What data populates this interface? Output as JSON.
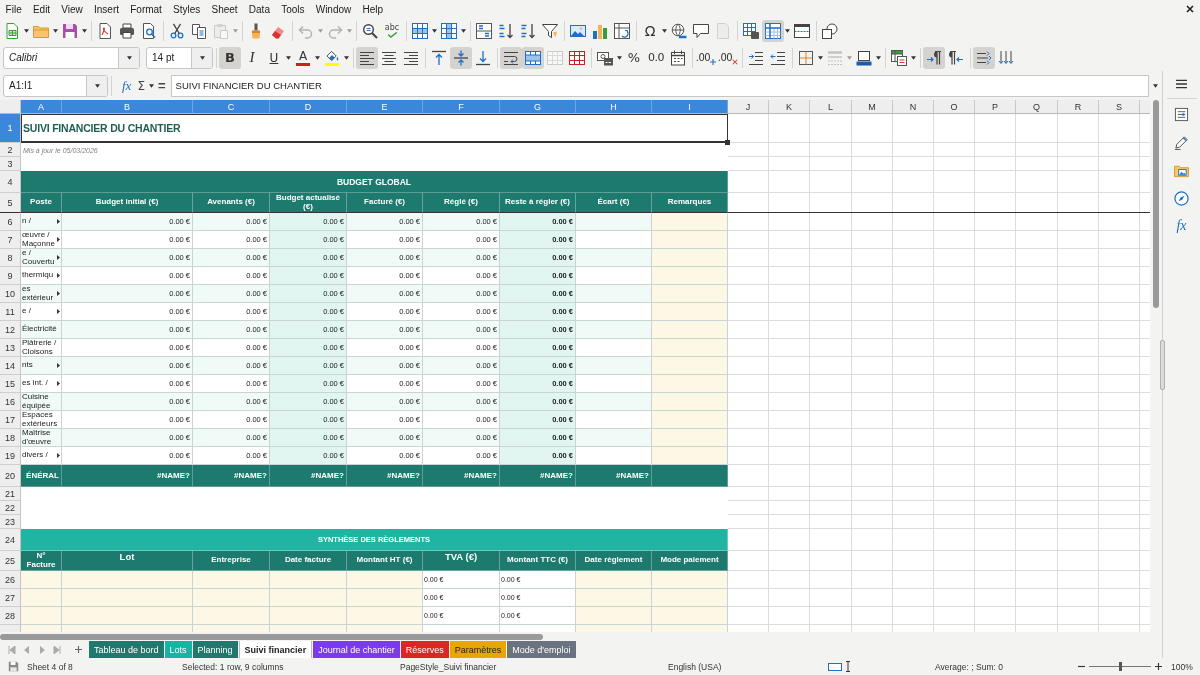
{
  "menu_bar": [
    "File",
    "Edit",
    "View",
    "Insert",
    "Format",
    "Styles",
    "Sheet",
    "Data",
    "Tools",
    "Window",
    "Help"
  ],
  "standard_toolbar": [
    {
      "pressed": false,
      "disabled": false
    },
    {
      "pressed": false,
      "disabled": false
    },
    {
      "pressed": false,
      "disabled": false
    },
    {
      "pressed": false,
      "disabled": false
    },
    {
      "pressed": false,
      "disabled": false
    },
    {
      "pressed": false,
      "disabled": false
    },
    {
      "pressed": false,
      "disabled": false
    },
    {
      "pressed": false,
      "disabled": false
    },
    {
      "pressed": false,
      "disabled": true
    },
    {
      "pressed": false,
      "disabled": false
    },
    {
      "pressed": false,
      "disabled": false
    },
    {
      "pressed": false,
      "disabled": true
    },
    {
      "pressed": false,
      "disabled": true
    },
    {
      "pressed": false,
      "disabled": false
    },
    {
      "pressed": false,
      "disabled": false,
      "glyph": "abc"
    },
    {
      "pressed": false,
      "disabled": false
    },
    {
      "pressed": false,
      "disabled": false
    },
    {
      "pressed": false,
      "disabled": false
    },
    {
      "pressed": false,
      "disabled": false
    },
    {
      "pressed": false,
      "disabled": false
    },
    {
      "pressed": false,
      "disabled": false
    },
    {
      "pressed": false,
      "disabled": false
    },
    {
      "pressed": false,
      "disabled": false
    },
    {
      "pressed": false,
      "disabled": false
    },
    {
      "pressed": false,
      "disabled": false,
      "glyph": "Ω"
    },
    {
      "pressed": false,
      "disabled": false
    },
    {
      "pressed": false,
      "disabled": false
    },
    {
      "pressed": false,
      "disabled": true
    },
    {
      "pressed": false,
      "disabled": false
    },
    {
      "pressed": true,
      "disabled": false
    },
    {
      "pressed": false,
      "disabled": false
    },
    {
      "pressed": false,
      "disabled": false
    }
  ],
  "formatting_toolbar": {
    "font_name": "Calibri",
    "font_size": "14 pt",
    "buttons": [
      {
        "pressed": true,
        "disabled": false,
        "glyph": "B"
      },
      {
        "pressed": false,
        "disabled": false,
        "glyph": "I"
      },
      {
        "pressed": false,
        "disabled": false,
        "glyph": "U"
      },
      {
        "pressed": false,
        "disabled": false,
        "glyph": "A",
        "color": "#c9211e"
      },
      {
        "pressed": false,
        "disabled": false,
        "color": "#ffff00"
      },
      {
        "pressed": true,
        "disabled": false
      },
      {
        "pressed": false,
        "disabled": false
      },
      {
        "pressed": false,
        "disabled": false
      },
      {
        "pressed": false,
        "disabled": false
      },
      {
        "pressed": true,
        "disabled": false
      },
      {
        "pressed": false,
        "disabled": false
      },
      {
        "pressed": true,
        "disabled": false
      },
      {
        "pressed": true,
        "disabled": false
      },
      {
        "pressed": false,
        "disabled": true
      },
      {
        "pressed": false,
        "disabled": false
      },
      {
        "pressed": false,
        "disabled": false
      },
      {
        "pressed": false,
        "disabled": false,
        "glyph": "%"
      },
      {
        "pressed": false,
        "disabled": false,
        "glyph": "0.0"
      },
      {
        "pressed": false,
        "disabled": false
      },
      {
        "pressed": false,
        "disabled": false,
        "glyph": ".00"
      },
      {
        "pressed": false,
        "disabled": false,
        "glyph": ".00"
      },
      {
        "pressed": false,
        "disabled": false
      },
      {
        "pressed": false,
        "disabled": false
      },
      {
        "pressed": false,
        "disabled": false
      },
      {
        "pressed": false,
        "disabled": true
      },
      {
        "pressed": false,
        "disabled": false
      },
      {
        "pressed": false,
        "disabled": false
      },
      {
        "pressed": true,
        "disabled": false
      },
      {
        "pressed": false,
        "disabled": false
      },
      {
        "pressed": true,
        "disabled": false
      },
      {
        "pressed": false,
        "disabled": false
      }
    ]
  },
  "formula_bar": {
    "name_box": "A1:I1",
    "function_wizard": "fx",
    "sum": "Σ",
    "equals": "=",
    "content": "SUIVI FINANCIER DU CHANTIER"
  },
  "sidebar": {
    "functions": "fx"
  },
  "sheet": {
    "columns": [
      {
        "label": "A",
        "selected": true
      },
      {
        "label": "B",
        "selected": true
      },
      {
        "label": "C",
        "selected": true
      },
      {
        "label": "D",
        "selected": true
      },
      {
        "label": "E",
        "selected": true
      },
      {
        "label": "F",
        "selected": true
      },
      {
        "label": "G",
        "selected": true
      },
      {
        "label": "H",
        "selected": true
      },
      {
        "label": "I",
        "selected": true
      },
      {
        "label": "J",
        "selected": false
      },
      {
        "label": "K",
        "selected": false
      },
      {
        "label": "L",
        "selected": false
      },
      {
        "label": "M",
        "selected": false
      },
      {
        "label": "N",
        "selected": false
      },
      {
        "label": "O",
        "selected": false
      },
      {
        "label": "P",
        "selected": false
      },
      {
        "label": "Q",
        "selected": false
      },
      {
        "label": "R",
        "selected": false
      },
      {
        "label": "S",
        "selected": false
      }
    ],
    "rows": [
      {
        "label": "1",
        "selected": true
      },
      {
        "label": "2",
        "selected": false
      },
      {
        "label": "3",
        "selected": false
      },
      {
        "label": "4",
        "selected": false
      },
      {
        "label": "5",
        "selected": false
      },
      {
        "label": "6",
        "selected": false
      },
      {
        "label": "7",
        "selected": false
      },
      {
        "label": "8",
        "selected": false
      },
      {
        "label": "9",
        "selected": false
      },
      {
        "label": "10",
        "selected": false
      },
      {
        "label": "11",
        "selected": false
      },
      {
        "label": "12",
        "selected": false
      },
      {
        "label": "13",
        "selected": false
      },
      {
        "label": "14",
        "selected": false
      },
      {
        "label": "15",
        "selected": false
      },
      {
        "label": "16",
        "selected": false
      },
      {
        "label": "17",
        "selected": false
      },
      {
        "label": "18",
        "selected": false
      },
      {
        "label": "19",
        "selected": false
      },
      {
        "label": "20",
        "selected": false
      },
      {
        "label": "21",
        "selected": false
      },
      {
        "label": "22",
        "selected": false
      },
      {
        "label": "23",
        "selected": false
      },
      {
        "label": "24",
        "selected": false
      },
      {
        "label": "25",
        "selected": false
      },
      {
        "label": "26",
        "selected": false
      },
      {
        "label": "27",
        "selected": false
      },
      {
        "label": "28",
        "selected": false
      }
    ],
    "title": "SUIVI FINANCIER DU CHANTIER",
    "subtitle": "Mis à jour le 05/03/2026",
    "budget": {
      "title": "BUDGET GLOBAL",
      "columns": [
        "Poste",
        "Budget initial (€)",
        "Avenants (€)",
        "Budget actualisé (€)",
        "Facturé (€)",
        "Réglé (€)",
        "Reste à régler (€)",
        "Écart (€)",
        "Remarques"
      ],
      "rows": [
        {
          "poste": "n /",
          "overflow": true,
          "values": [
            "0.00 €",
            "0.00 €",
            "0.00 €",
            "0.00 €",
            "0.00 €",
            "0.00 €"
          ]
        },
        {
          "poste": "œuvre /\nMaçonne",
          "overflow": true,
          "values": [
            "0.00 €",
            "0.00 €",
            "0.00 €",
            "0.00 €",
            "0.00 €",
            "0.00 €"
          ]
        },
        {
          "poste": "e /\nCouvertu",
          "overflow": true,
          "values": [
            "0.00 €",
            "0.00 €",
            "0.00 €",
            "0.00 €",
            "0.00 €",
            "0.00 €"
          ]
        },
        {
          "poste": "thermiqu",
          "overflow": true,
          "values": [
            "0.00 €",
            "0.00 €",
            "0.00 €",
            "0.00 €",
            "0.00 €",
            "0.00 €"
          ]
        },
        {
          "poste": "es\nextérieur",
          "overflow": true,
          "values": [
            "0.00 €",
            "0.00 €",
            "0.00 €",
            "0.00 €",
            "0.00 €",
            "0.00 €"
          ]
        },
        {
          "poste": "e /",
          "overflow": true,
          "values": [
            "0.00 €",
            "0.00 €",
            "0.00 €",
            "0.00 €",
            "0.00 €",
            "0.00 €"
          ]
        },
        {
          "poste": "Électricité",
          "overflow": false,
          "values": [
            "0.00 €",
            "0.00 €",
            "0.00 €",
            "0.00 €",
            "0.00 €",
            "0.00 €"
          ]
        },
        {
          "poste": "Plâtrerie /\nCloisons",
          "overflow": false,
          "values": [
            "0.00 €",
            "0.00 €",
            "0.00 €",
            "0.00 €",
            "0.00 €",
            "0.00 €"
          ]
        },
        {
          "poste": "nts",
          "overflow": true,
          "values": [
            "0.00 €",
            "0.00 €",
            "0.00 €",
            "0.00 €",
            "0.00 €",
            "0.00 €"
          ]
        },
        {
          "poste": "es int. /",
          "overflow": true,
          "values": [
            "0.00 €",
            "0.00 €",
            "0.00 €",
            "0.00 €",
            "0.00 €",
            "0.00 €"
          ]
        },
        {
          "poste": "Cuisine\néquipée",
          "overflow": false,
          "values": [
            "0.00 €",
            "0.00 €",
            "0.00 €",
            "0.00 €",
            "0.00 €",
            "0.00 €"
          ]
        },
        {
          "poste": "Espaces\nextérieurs",
          "overflow": false,
          "values": [
            "0.00 €",
            "0.00 €",
            "0.00 €",
            "0.00 €",
            "0.00 €",
            "0.00 €"
          ]
        },
        {
          "poste": "Maîtrise\nd'œuvre",
          "overflow": false,
          "values": [
            "0.00 €",
            "0.00 €",
            "0.00 €",
            "0.00 €",
            "0.00 €",
            "0.00 €"
          ]
        },
        {
          "poste": "divers /",
          "overflow": true,
          "values": [
            "0.00 €",
            "0.00 €",
            "0.00 €",
            "0.00 €",
            "0.00 €",
            "0.00 €"
          ]
        }
      ],
      "total": {
        "label": "ÉNÉRAL",
        "values": [
          "#NAME?",
          "#NAME?",
          "#NAME?",
          "#NAME?",
          "#NAME?",
          "#NAME?",
          "#NAME?"
        ]
      }
    },
    "payments": {
      "title": "SYNTHÈSE DES RÈGLEMENTS",
      "columns": [
        "N° Facture",
        "Lot",
        "Entreprise",
        "Date facture",
        "Montant HT (€)",
        "TVA (€)",
        "Montant TTC (€)",
        "Date règlement",
        "Mode paiement"
      ],
      "rows": [
        {
          "tva": "0.00 €",
          "ttc": "0.00 €"
        },
        {
          "tva": "0.00 €",
          "ttc": "0.00 €"
        },
        {
          "tva": "0.00 €",
          "ttc": "0.00 €"
        }
      ]
    }
  },
  "sheet_tabs": [
    {
      "label": "Tableau de bord",
      "color": "#1f7a6d",
      "selected": false
    },
    {
      "label": "Lots",
      "color": "#17b3a3",
      "selected": false
    },
    {
      "label": "Planning",
      "color": "#22786c",
      "selected": false
    },
    {
      "label": "Suivi financier",
      "color": "#ffffff",
      "selected": true
    },
    {
      "label": "Journal de chantier",
      "color": "#7c3aed",
      "selected": false
    },
    {
      "label": "Réserves",
      "color": "#dc2626",
      "selected": false
    },
    {
      "label": "Paramètres",
      "color": "#e6a700",
      "selected": false
    },
    {
      "label": "Mode d'emploi",
      "color": "#6b7280",
      "selected": false
    }
  ],
  "status_bar": {
    "sheet": "Sheet 4 of 8",
    "selection": "Selected: 1 row, 9 columns",
    "page_style": "PageStyle_Suivi financier",
    "language": "English (USA)",
    "summary": "Average: ; Sum: 0",
    "zoom": {
      "level": 0.5,
      "label": "100%"
    }
  }
}
